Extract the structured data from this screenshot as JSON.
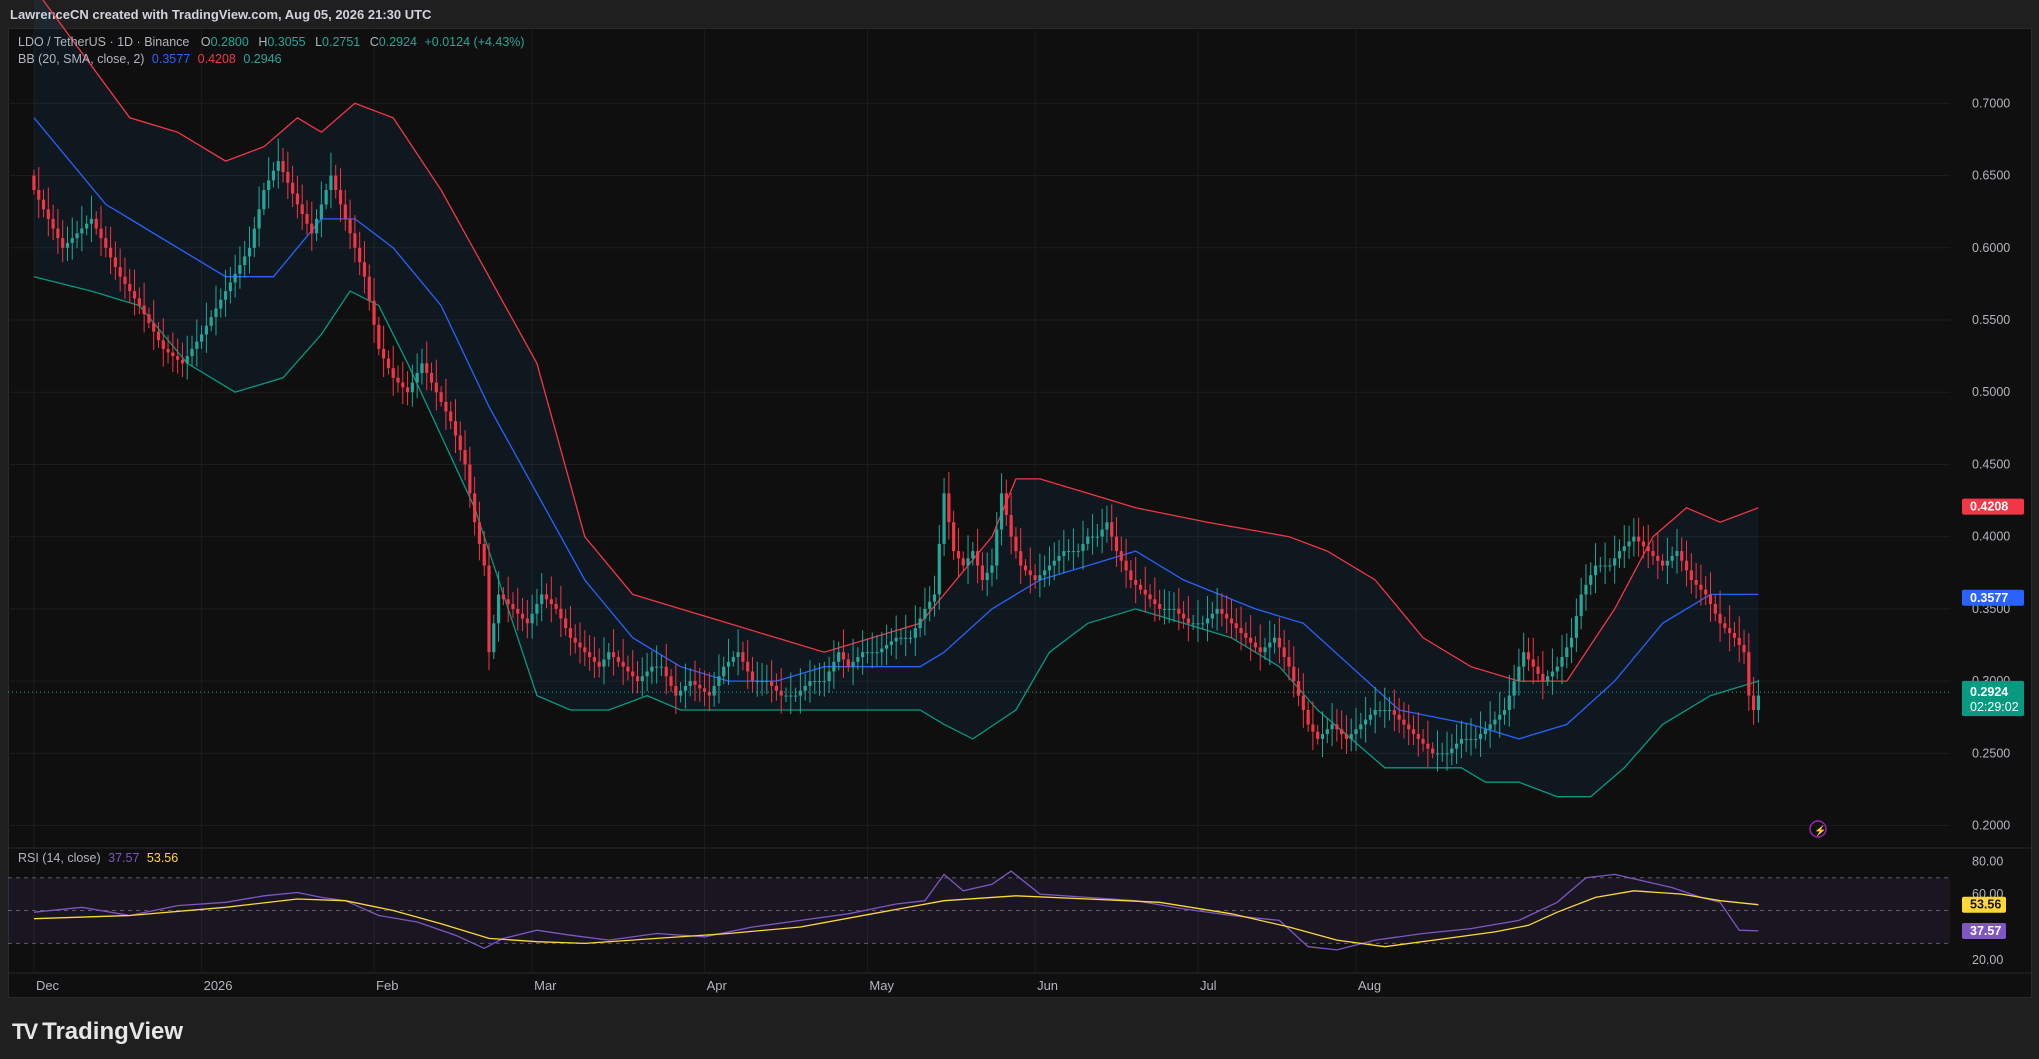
{
  "header": {
    "caption": "LawrenceCN created with TradingView.com, Aug 05, 2026 21:30 UTC"
  },
  "legend": {
    "symbol": "LDO / TetherUS · 1D · Binance",
    "open_label": "O",
    "open": "0.2800",
    "high_label": "H",
    "high": "0.3055",
    "low_label": "L",
    "low": "0.2751",
    "close_label": "C",
    "close": "0.2924",
    "change": "+0.0124 (+4.43%)",
    "bb_label": "BB (20, SMA, close, 2)",
    "bb_basis": "0.3577",
    "bb_upper": "0.4208",
    "bb_lower": "0.2946",
    "rsi_label": "RSI (14, close)",
    "rsi_value": "37.57",
    "rsi_ma": "53.56"
  },
  "brand": {
    "name": "TradingView",
    "logo_text": "TV"
  },
  "colors": {
    "up": "#26a69a",
    "down": "#f23645",
    "bb_upper": "#f23645",
    "bb_basis": "#2962ff",
    "bb_lower": "#089981",
    "rsi": "#7e57c2",
    "rsi_ma": "#fdd835"
  },
  "chart_data": [
    {
      "type": "candlestick",
      "title": "LDO / TetherUS · 1D · Binance",
      "ylim": [
        0.19,
        0.73
      ],
      "yticks": [
        "0.7000",
        "0.6500",
        "0.6000",
        "0.5500",
        "0.5000",
        "0.4500",
        "0.4000",
        "0.3500",
        "0.3000",
        "0.2500",
        "0.2000"
      ],
      "x_labels": [
        "Dec",
        "2026",
        "Feb",
        "Mar",
        "Apr",
        "May",
        "Jun",
        "Jul",
        "Aug"
      ],
      "price_labels": {
        "bb_upper": "0.4208",
        "bb_basis": "0.3577",
        "bb_lower": "0.2946",
        "last": "0.2924",
        "countdown": "02:29:02"
      },
      "close_path": [
        [
          0,
          0.64
        ],
        [
          6,
          0.6
        ],
        [
          12,
          0.62
        ],
        [
          18,
          0.58
        ],
        [
          22,
          0.56
        ],
        [
          27,
          0.53
        ],
        [
          31,
          0.52
        ],
        [
          35,
          0.54
        ],
        [
          40,
          0.57
        ],
        [
          45,
          0.6
        ],
        [
          48,
          0.64
        ],
        [
          51,
          0.66
        ],
        [
          55,
          0.63
        ],
        [
          58,
          0.61
        ],
        [
          62,
          0.65
        ],
        [
          65,
          0.62
        ],
        [
          69,
          0.58
        ],
        [
          72,
          0.53
        ],
        [
          75,
          0.51
        ],
        [
          78,
          0.5
        ],
        [
          81,
          0.52
        ],
        [
          84,
          0.5
        ],
        [
          87,
          0.48
        ],
        [
          90,
          0.45
        ],
        [
          92,
          0.41
        ],
        [
          94,
          0.38
        ],
        [
          95,
          0.32
        ],
        [
          97,
          0.36
        ],
        [
          100,
          0.35
        ],
        [
          103,
          0.34
        ],
        [
          106,
          0.36
        ],
        [
          109,
          0.35
        ],
        [
          112,
          0.33
        ],
        [
          115,
          0.32
        ],
        [
          118,
          0.31
        ],
        [
          120,
          0.32
        ],
        [
          123,
          0.31
        ],
        [
          126,
          0.3
        ],
        [
          129,
          0.31
        ],
        [
          131,
          0.31
        ],
        [
          134,
          0.29
        ],
        [
          137,
          0.3
        ],
        [
          141,
          0.29
        ],
        [
          144,
          0.31
        ],
        [
          147,
          0.32
        ],
        [
          150,
          0.3
        ],
        [
          153,
          0.3
        ],
        [
          156,
          0.29
        ],
        [
          159,
          0.29
        ],
        [
          162,
          0.3
        ],
        [
          165,
          0.3
        ],
        [
          168,
          0.32
        ],
        [
          170,
          0.31
        ],
        [
          173,
          0.32
        ],
        [
          176,
          0.32
        ],
        [
          180,
          0.33
        ],
        [
          183,
          0.33
        ],
        [
          186,
          0.35
        ],
        [
          188,
          0.36
        ],
        [
          190,
          0.43
        ],
        [
          192,
          0.39
        ],
        [
          194,
          0.38
        ],
        [
          196,
          0.39
        ],
        [
          198,
          0.37
        ],
        [
          200,
          0.38
        ],
        [
          202,
          0.43
        ],
        [
          204,
          0.4
        ],
        [
          206,
          0.38
        ],
        [
          209,
          0.37
        ],
        [
          212,
          0.38
        ],
        [
          215,
          0.39
        ],
        [
          218,
          0.39
        ],
        [
          220,
          0.4
        ],
        [
          222,
          0.4
        ],
        [
          224,
          0.41
        ],
        [
          226,
          0.39
        ],
        [
          229,
          0.37
        ],
        [
          232,
          0.36
        ],
        [
          235,
          0.35
        ],
        [
          238,
          0.35
        ],
        [
          241,
          0.34
        ],
        [
          244,
          0.34
        ],
        [
          247,
          0.35
        ],
        [
          250,
          0.34
        ],
        [
          253,
          0.33
        ],
        [
          256,
          0.32
        ],
        [
          259,
          0.33
        ],
        [
          262,
          0.31
        ],
        [
          264,
          0.29
        ],
        [
          266,
          0.27
        ],
        [
          268,
          0.26
        ],
        [
          271,
          0.27
        ],
        [
          274,
          0.26
        ],
        [
          277,
          0.27
        ],
        [
          280,
          0.28
        ],
        [
          283,
          0.28
        ],
        [
          286,
          0.27
        ],
        [
          289,
          0.26
        ],
        [
          292,
          0.25
        ],
        [
          295,
          0.25
        ],
        [
          298,
          0.26
        ],
        [
          301,
          0.26
        ],
        [
          304,
          0.27
        ],
        [
          307,
          0.28
        ],
        [
          309,
          0.3
        ],
        [
          311,
          0.32
        ],
        [
          313,
          0.31
        ],
        [
          315,
          0.3
        ],
        [
          318,
          0.31
        ],
        [
          321,
          0.33
        ],
        [
          323,
          0.36
        ],
        [
          326,
          0.38
        ],
        [
          329,
          0.38
        ],
        [
          331,
          0.39
        ],
        [
          334,
          0.4
        ],
        [
          337,
          0.39
        ],
        [
          340,
          0.38
        ],
        [
          343,
          0.39
        ],
        [
          346,
          0.37
        ],
        [
          349,
          0.36
        ],
        [
          352,
          0.34
        ],
        [
          355,
          0.33
        ],
        [
          357,
          0.32
        ],
        [
          358,
          0.29
        ],
        [
          359,
          0.28
        ],
        [
          360,
          0.29
        ]
      ],
      "bb_upper_path": [
        [
          0,
          0.78
        ],
        [
          20,
          0.69
        ],
        [
          30,
          0.68
        ],
        [
          40,
          0.66
        ],
        [
          48,
          0.67
        ],
        [
          55,
          0.69
        ],
        [
          60,
          0.68
        ],
        [
          67,
          0.7
        ],
        [
          75,
          0.69
        ],
        [
          85,
          0.64
        ],
        [
          95,
          0.58
        ],
        [
          105,
          0.52
        ],
        [
          115,
          0.4
        ],
        [
          125,
          0.36
        ],
        [
          135,
          0.35
        ],
        [
          145,
          0.34
        ],
        [
          155,
          0.33
        ],
        [
          165,
          0.32
        ],
        [
          175,
          0.33
        ],
        [
          185,
          0.34
        ],
        [
          190,
          0.36
        ],
        [
          200,
          0.4
        ],
        [
          205,
          0.44
        ],
        [
          210,
          0.44
        ],
        [
          220,
          0.43
        ],
        [
          230,
          0.42
        ],
        [
          245,
          0.41
        ],
        [
          262,
          0.4
        ],
        [
          270,
          0.39
        ],
        [
          280,
          0.37
        ],
        [
          290,
          0.33
        ],
        [
          300,
          0.31
        ],
        [
          310,
          0.3
        ],
        [
          320,
          0.3
        ],
        [
          330,
          0.35
        ],
        [
          338,
          0.4
        ],
        [
          345,
          0.42
        ],
        [
          352,
          0.41
        ],
        [
          360,
          0.42
        ]
      ],
      "bb_basis_path": [
        [
          0,
          0.69
        ],
        [
          15,
          0.63
        ],
        [
          30,
          0.6
        ],
        [
          40,
          0.58
        ],
        [
          50,
          0.58
        ],
        [
          60,
          0.62
        ],
        [
          67,
          0.62
        ],
        [
          75,
          0.6
        ],
        [
          85,
          0.56
        ],
        [
          95,
          0.49
        ],
        [
          105,
          0.43
        ],
        [
          115,
          0.37
        ],
        [
          125,
          0.33
        ],
        [
          135,
          0.31
        ],
        [
          145,
          0.3
        ],
        [
          155,
          0.3
        ],
        [
          165,
          0.31
        ],
        [
          175,
          0.31
        ],
        [
          185,
          0.31
        ],
        [
          190,
          0.32
        ],
        [
          200,
          0.35
        ],
        [
          210,
          0.37
        ],
        [
          220,
          0.38
        ],
        [
          230,
          0.39
        ],
        [
          240,
          0.37
        ],
        [
          255,
          0.35
        ],
        [
          265,
          0.34
        ],
        [
          275,
          0.31
        ],
        [
          285,
          0.28
        ],
        [
          300,
          0.27
        ],
        [
          310,
          0.26
        ],
        [
          320,
          0.27
        ],
        [
          330,
          0.3
        ],
        [
          340,
          0.34
        ],
        [
          350,
          0.36
        ],
        [
          356,
          0.36
        ],
        [
          360,
          0.36
        ]
      ],
      "bb_lower_path": [
        [
          0,
          0.58
        ],
        [
          12,
          0.57
        ],
        [
          22,
          0.56
        ],
        [
          32,
          0.52
        ],
        [
          42,
          0.5
        ],
        [
          52,
          0.51
        ],
        [
          60,
          0.54
        ],
        [
          66,
          0.57
        ],
        [
          72,
          0.56
        ],
        [
          78,
          0.52
        ],
        [
          85,
          0.47
        ],
        [
          92,
          0.42
        ],
        [
          98,
          0.36
        ],
        [
          105,
          0.29
        ],
        [
          112,
          0.28
        ],
        [
          120,
          0.28
        ],
        [
          128,
          0.29
        ],
        [
          135,
          0.28
        ],
        [
          145,
          0.28
        ],
        [
          155,
          0.28
        ],
        [
          165,
          0.28
        ],
        [
          175,
          0.28
        ],
        [
          185,
          0.28
        ],
        [
          190,
          0.27
        ],
        [
          196,
          0.26
        ],
        [
          205,
          0.28
        ],
        [
          212,
          0.32
        ],
        [
          220,
          0.34
        ],
        [
          230,
          0.35
        ],
        [
          240,
          0.34
        ],
        [
          250,
          0.33
        ],
        [
          260,
          0.31
        ],
        [
          268,
          0.28
        ],
        [
          275,
          0.26
        ],
        [
          282,
          0.24
        ],
        [
          290,
          0.24
        ],
        [
          298,
          0.24
        ],
        [
          303,
          0.23
        ],
        [
          310,
          0.23
        ],
        [
          318,
          0.22
        ],
        [
          325,
          0.22
        ],
        [
          332,
          0.24
        ],
        [
          340,
          0.27
        ],
        [
          350,
          0.29
        ],
        [
          360,
          0.3
        ]
      ]
    },
    {
      "type": "line",
      "title": "RSI (14, close)",
      "ylim": [
        15,
        82
      ],
      "yticks": [
        "80.00",
        "60.00",
        "20.00"
      ],
      "levels": [
        70,
        50,
        30
      ],
      "series": [
        {
          "name": "RSI",
          "points": [
            [
              0,
              49
            ],
            [
              10,
              52
            ],
            [
              20,
              47
            ],
            [
              30,
              53
            ],
            [
              40,
              55
            ],
            [
              48,
              59
            ],
            [
              55,
              61
            ],
            [
              60,
              58
            ],
            [
              65,
              56
            ],
            [
              72,
              47
            ],
            [
              80,
              43
            ],
            [
              88,
              35
            ],
            [
              94,
              27
            ],
            [
              98,
              33
            ],
            [
              105,
              38
            ],
            [
              112,
              35
            ],
            [
              120,
              32
            ],
            [
              130,
              36
            ],
            [
              140,
              34
            ],
            [
              150,
              40
            ],
            [
              160,
              44
            ],
            [
              170,
              48
            ],
            [
              180,
              54
            ],
            [
              186,
              56
            ],
            [
              190,
              72
            ],
            [
              194,
              62
            ],
            [
              200,
              66
            ],
            [
              204,
              74
            ],
            [
              210,
              60
            ],
            [
              220,
              58
            ],
            [
              230,
              56
            ],
            [
              240,
              51
            ],
            [
              250,
              47
            ],
            [
              260,
              44
            ],
            [
              266,
              28
            ],
            [
              272,
              26
            ],
            [
              280,
              32
            ],
            [
              290,
              36
            ],
            [
              300,
              39
            ],
            [
              310,
              44
            ],
            [
              318,
              55
            ],
            [
              324,
              70
            ],
            [
              330,
              72
            ],
            [
              336,
              68
            ],
            [
              342,
              64
            ],
            [
              348,
              58
            ],
            [
              352,
              55
            ],
            [
              356,
              38
            ],
            [
              360,
              37.57
            ]
          ]
        },
        {
          "name": "RSI-based MA",
          "points": [
            [
              0,
              45
            ],
            [
              20,
              47
            ],
            [
              40,
              52
            ],
            [
              55,
              57
            ],
            [
              65,
              56
            ],
            [
              75,
              50
            ],
            [
              85,
              42
            ],
            [
              95,
              33
            ],
            [
              105,
              31
            ],
            [
              115,
              30
            ],
            [
              130,
              33
            ],
            [
              145,
              36
            ],
            [
              160,
              40
            ],
            [
              175,
              48
            ],
            [
              190,
              56
            ],
            [
              205,
              59
            ],
            [
              220,
              57
            ],
            [
              235,
              55
            ],
            [
              250,
              48
            ],
            [
              262,
              40
            ],
            [
              272,
              32
            ],
            [
              282,
              28
            ],
            [
              295,
              33
            ],
            [
              305,
              37
            ],
            [
              312,
              41
            ],
            [
              318,
              49
            ],
            [
              326,
              58
            ],
            [
              334,
              62
            ],
            [
              344,
              60
            ],
            [
              352,
              56
            ],
            [
              360,
              53.56
            ]
          ]
        }
      ]
    }
  ]
}
